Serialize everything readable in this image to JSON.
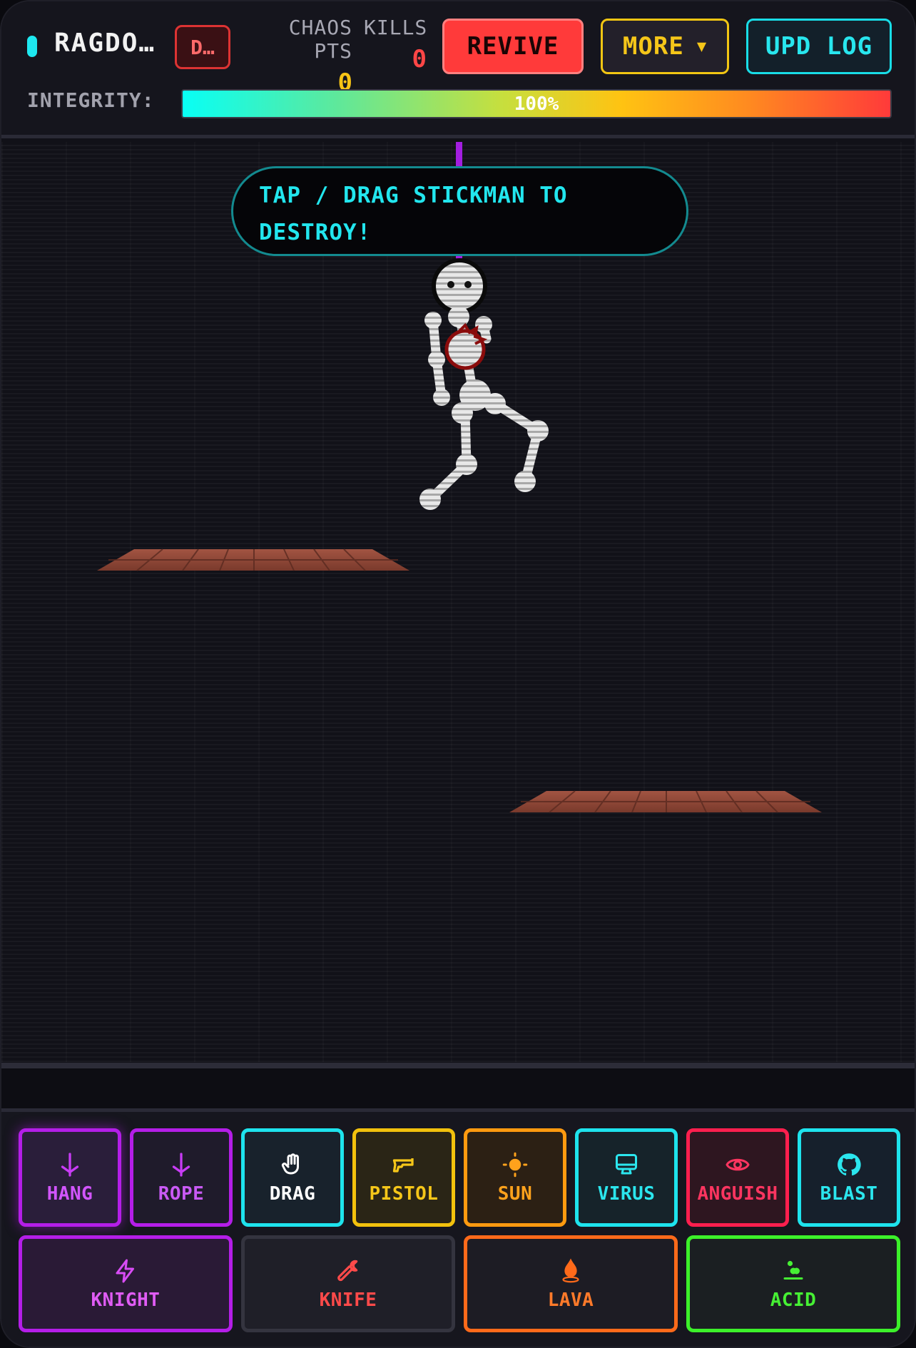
{
  "header": {
    "title": "RAGDO…",
    "mode_button": "D…",
    "chaos_label": "CHAOS PTS",
    "chaos_value": "0",
    "kills_label": "KILLS",
    "kills_value": "0",
    "revive_label": "REVIVE",
    "more_label": "MORE",
    "more_icon": "triangle-down",
    "update_log_label": "UPD LOG",
    "integrity_label": "INTEGRITY:",
    "integrity_value": 1.0,
    "integrity_text": "100%"
  },
  "play_area": {
    "hint": "TAP / DRAG STICKMAN TO DESTROY!"
  },
  "tools": {
    "row1": [
      {
        "id": "hang",
        "label": "HANG",
        "icon": "anchor-icon",
        "color": "#b41ee8",
        "active": true
      },
      {
        "id": "rope",
        "label": "ROPE",
        "icon": "anchor-icon",
        "color": "#b41ee8"
      },
      {
        "id": "drag",
        "label": "DRAG",
        "icon": "hand-icon",
        "color": "#1ee3ed"
      },
      {
        "id": "pistol",
        "label": "PISTOL",
        "icon": "gun-icon",
        "color": "#f2c10d"
      },
      {
        "id": "sun",
        "label": "SUN",
        "icon": "sun-icon",
        "color": "#ff9a10"
      },
      {
        "id": "virus",
        "label": "VIRUS",
        "icon": "monitor-icon",
        "color": "#1ee3ed"
      },
      {
        "id": "anguish",
        "label": "ANGUISH",
        "icon": "eye-icon",
        "color": "#ff1f4e"
      },
      {
        "id": "blast",
        "label": "BLAST",
        "icon": "github-icon",
        "color": "#1ee3ed"
      }
    ],
    "row2": [
      {
        "id": "knight",
        "label": "KNIGHT",
        "icon": "bolt-icon",
        "color": "#b41ee8"
      },
      {
        "id": "knife",
        "label": "KNIFE",
        "icon": "wrench-icon",
        "color": "#ff4a4a"
      },
      {
        "id": "lava",
        "label": "LAVA",
        "icon": "flame-icon",
        "color": "#ff6a1a"
      },
      {
        "id": "acid",
        "label": "ACID",
        "icon": "drops-icon",
        "color": "#3cf02a"
      }
    ]
  }
}
